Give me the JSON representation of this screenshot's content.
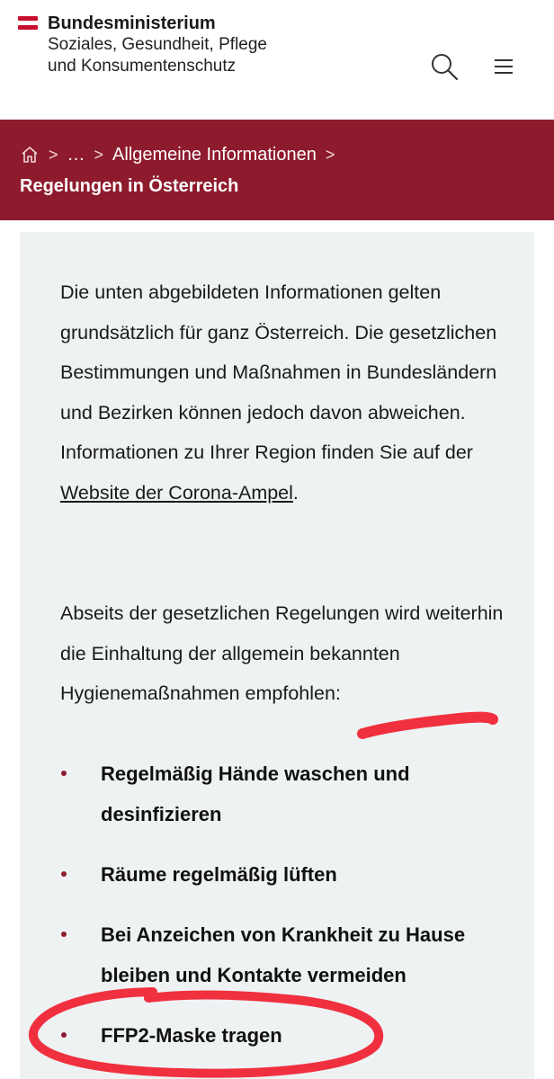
{
  "header": {
    "ministry_line1": "Bundesministerium",
    "ministry_line2": "Soziales, Gesundheit, Pflege",
    "ministry_line3": "und Konsumentenschutz",
    "search_icon": "search-icon",
    "menu_icon": "hamburger-menu-icon",
    "flag_color": "#c8102e"
  },
  "breadcrumb": {
    "home_icon": "home-icon",
    "separator": ">",
    "ellipsis": "…",
    "parent": "Allgemeine Informationen",
    "current": "Regelungen in Österreich",
    "bar_color": "#8e1b2d"
  },
  "content": {
    "para1_text": "Die unten abgebildeten Informationen gelten grundsätzlich für ganz Österreich. Die gesetzlichen Bestimmungen und Maßnahmen in Bundesländern und Bezirken können jedoch davon abweichen. Informationen zu Ihrer Region finden Sie auf der ",
    "para1_link": "Website der Corona-Ampel",
    "para1_end": ".",
    "para2": "Abseits der gesetzlichen Regelungen wird weiterhin die Einhaltung der allgemein bekannten Hygienemaßnahmen empfohlen:",
    "bullets": [
      "Regelmäßig Hände waschen und desinfizieren",
      "Räume regelmäßig lüften",
      "Bei Anzeichen von Krankheit zu Hause bleiben und Kontakte vermeiden",
      "FFP2-Maske tragen"
    ],
    "card_color": "#eef2f3",
    "annotation_color": "#f0303f"
  }
}
